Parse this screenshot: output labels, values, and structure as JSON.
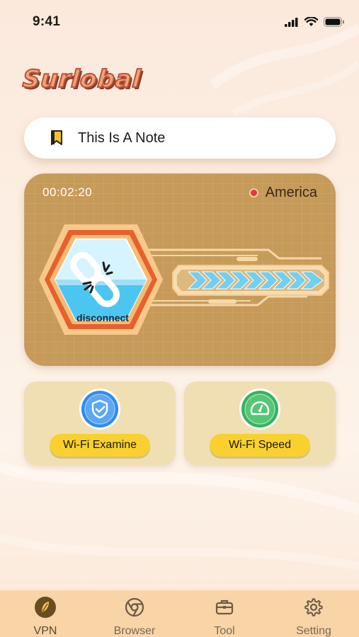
{
  "status_bar": {
    "time": "9:41"
  },
  "app": {
    "logo_text": "Surlobal"
  },
  "note": {
    "text": "This Is A Note"
  },
  "vpn_card": {
    "timer": "00:02:20",
    "location": "America",
    "action_label": "disconnect"
  },
  "features": [
    {
      "label": "Wi-Fi Examine",
      "icon": "shield-check-icon"
    },
    {
      "label": "Wi-Fi Speed",
      "icon": "speedometer-icon"
    }
  ],
  "tabs": [
    {
      "label": "VPN",
      "icon": "vpn-leaf-icon",
      "active": true
    },
    {
      "label": "Browser",
      "icon": "chrome-browser-icon",
      "active": false
    },
    {
      "label": "Tool",
      "icon": "toolbox-icon",
      "active": false
    },
    {
      "label": "Setting",
      "icon": "gear-icon",
      "active": false
    }
  ],
  "colors": {
    "card": "#c69a59",
    "accent_yellow": "#f8d12f",
    "blue": "#2f8bf0",
    "green": "#37b25b",
    "tab_bar": "#f8d4a6"
  }
}
